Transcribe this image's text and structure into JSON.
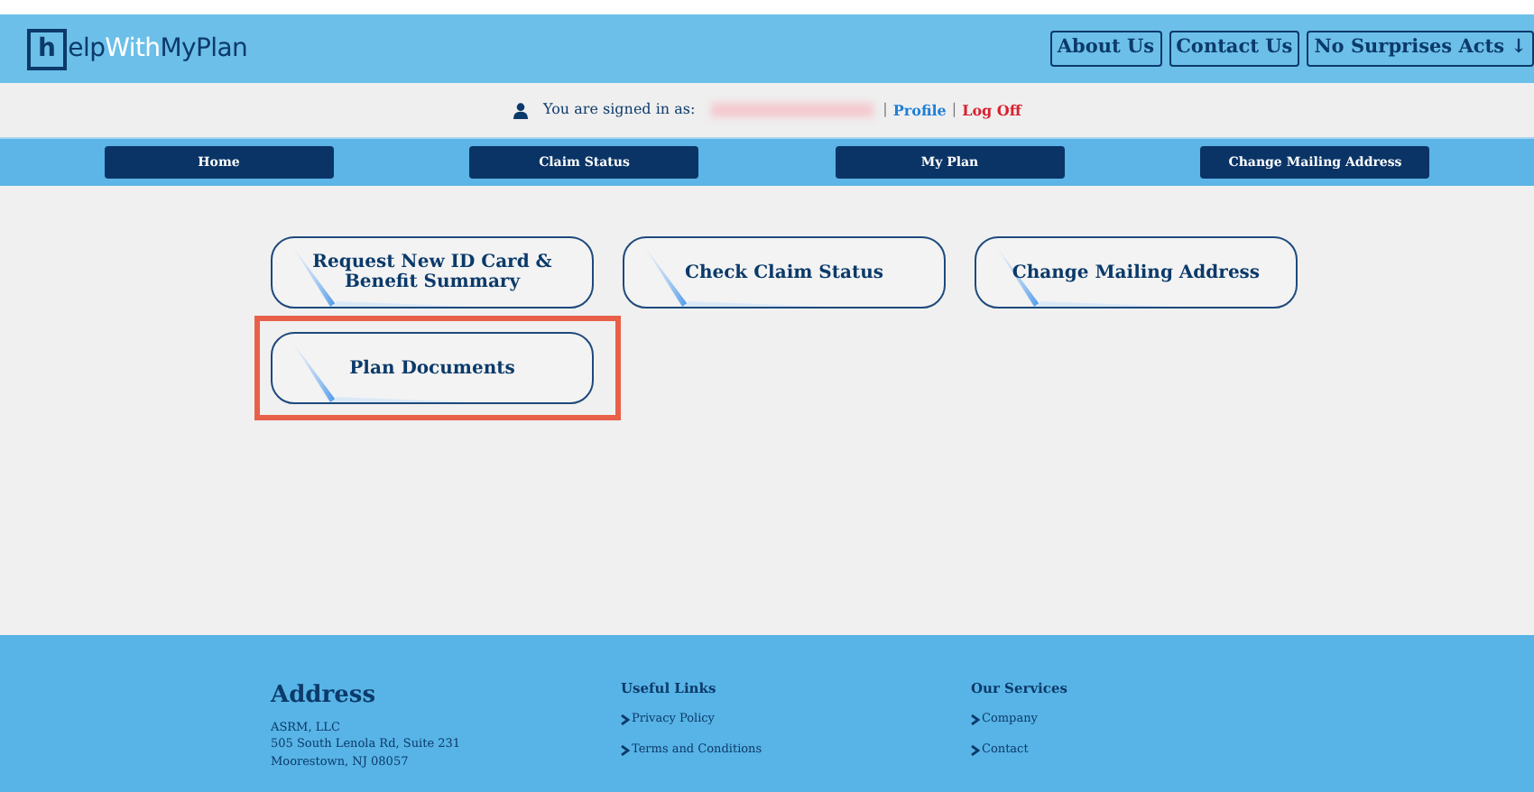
{
  "header": {
    "logo": [
      {
        "text": "h",
        "kind": "boxed"
      },
      {
        "text": "elp",
        "kind": "dark"
      },
      {
        "text": "With",
        "kind": "light"
      },
      {
        "text": "MyPlan",
        "kind": "dark"
      }
    ],
    "links": [
      "About Us",
      "Contact Us",
      "No Surprises Acts ↓"
    ]
  },
  "signin": {
    "label": "You are signed in as:",
    "links": [
      {
        "text": "|",
        "kind": "separator"
      },
      {
        "text": "Profile",
        "kind": "profile"
      },
      {
        "text": "|",
        "kind": "separator"
      },
      {
        "text": "Log Off",
        "kind": "logoff"
      }
    ]
  },
  "nav": [
    "Home",
    "Claim Status",
    "My Plan",
    "Change Mailing Address"
  ],
  "tiles": [
    {
      "label": "Request New ID Card & Benefit Summary",
      "highlighted": false
    },
    {
      "label": "Check Claim Status",
      "highlighted": false
    },
    {
      "label": "Change Mailing Address",
      "highlighted": false
    },
    {
      "label": "Plan Documents",
      "highlighted": true
    }
  ],
  "footer": {
    "address": {
      "title": "Address",
      "lines": [
        "ASRM, LLC",
        "505 South Lenola Rd, Suite 231",
        "Moorestown, NJ 08057"
      ]
    },
    "columns": [
      {
        "title": "Useful Links",
        "links": [
          "Privacy Policy",
          "Terms and Conditions"
        ]
      },
      {
        "title": "Our Services",
        "links": [
          "Company",
          "Contact"
        ]
      }
    ]
  }
}
